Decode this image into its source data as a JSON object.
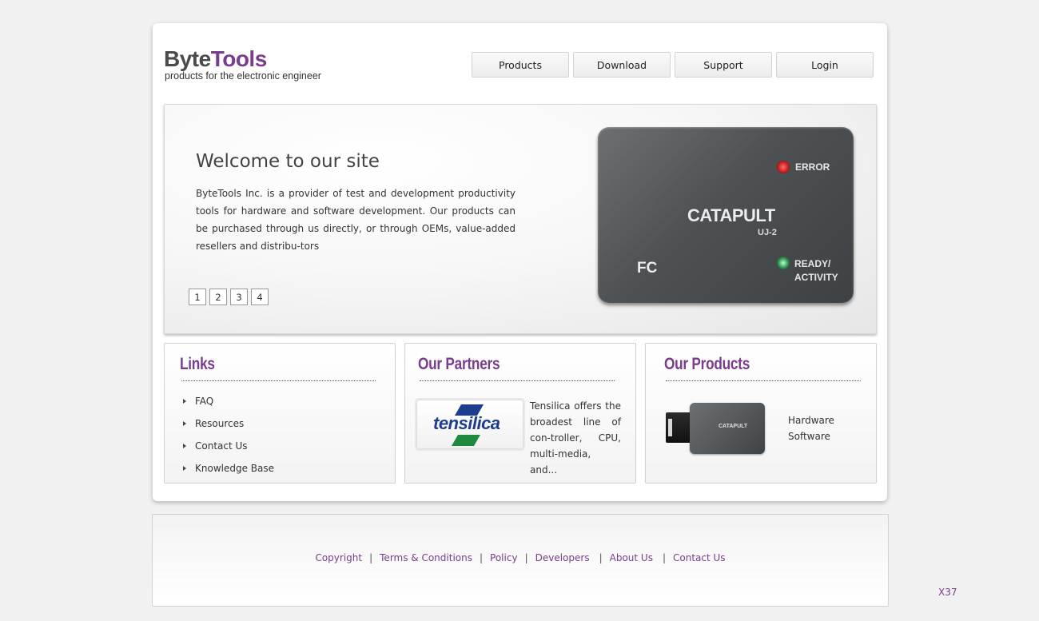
{
  "logo": {
    "word_part1": "Byte",
    "word_part2": "Tools",
    "tagline": "products for the electronic engineer"
  },
  "nav": {
    "items": [
      {
        "label": "Products"
      },
      {
        "label": "Download"
      },
      {
        "label": "Support"
      },
      {
        "label": "Login"
      }
    ]
  },
  "hero": {
    "title": "Welcome to our site",
    "text": "ByteTools Inc. is a provider of test and development productivity tools for hardware and software development. Our products can be purchased through us directly, or through OEMs, value-added resellers and distribu-tors",
    "pager": [
      "1",
      "2",
      "3",
      "4"
    ],
    "device": {
      "name": "CATAPULT",
      "model": "UJ-2",
      "led_error_label": "ERROR",
      "led_ready_label": "READY/",
      "led_activity_label": "ACTIVITY",
      "fc_mark": "FC"
    }
  },
  "links_panel": {
    "title": "Links",
    "items": [
      "FAQ",
      "Resources",
      "Contact Us",
      "Knowledge Base"
    ]
  },
  "partners_panel": {
    "title": "Our Partners",
    "logo_text": "tensilica",
    "text": "Tensilica offers the broadest line of con-troller, CPU, multi-media, and..."
  },
  "products_panel": {
    "title": "Our Products",
    "thumb_name": "CATAPULT",
    "items": [
      "Hardware",
      "Software"
    ]
  },
  "footer": {
    "links": [
      "Copyright",
      "Terms & Conditions",
      "Policy",
      "Developers",
      "About Us",
      "Contact Us"
    ],
    "separator": "|"
  },
  "page_code": "X37",
  "colors": {
    "brand_purple": "#7a3d8c",
    "text_dark": "#333333",
    "background": "#f1f1f1"
  }
}
